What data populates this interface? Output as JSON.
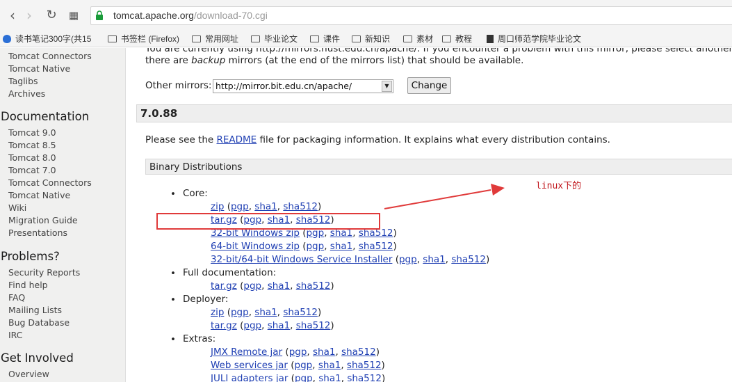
{
  "browser": {
    "url_host": "tomcat.apache.org",
    "url_path": "/download-70.cgi",
    "bookmarks": [
      {
        "label": "读书笔记300字(共15",
        "icon": "baidu-paw-icon"
      },
      {
        "label": "书签栏 (Firefox)",
        "icon": "folder-icon"
      },
      {
        "label": "常用网址",
        "icon": "folder-icon"
      },
      {
        "label": "毕业论文",
        "icon": "folder-icon"
      },
      {
        "label": "课件",
        "icon": "folder-icon"
      },
      {
        "label": "新知识",
        "icon": "folder-icon"
      },
      {
        "label": "素材",
        "icon": "folder-icon"
      },
      {
        "label": "教程",
        "icon": "folder-icon"
      },
      {
        "label": "周口师范学院毕业论文",
        "icon": "document-icon"
      }
    ]
  },
  "sidebar": {
    "top_items": [
      "Tomcat Connectors",
      "Tomcat Native",
      "Taglibs",
      "Archives"
    ],
    "documentation": {
      "heading": "Documentation",
      "items": [
        "Tomcat 9.0",
        "Tomcat 8.5",
        "Tomcat 8.0",
        "Tomcat 7.0",
        "Tomcat Connectors",
        "Tomcat Native",
        "Wiki",
        "Migration Guide",
        "Presentations"
      ]
    },
    "problems": {
      "heading": "Problems?",
      "items": [
        "Security Reports",
        "Find help",
        "FAQ",
        "Mailing Lists",
        "Bug Database",
        "IRC"
      ]
    },
    "involved": {
      "heading": "Get Involved",
      "items": [
        "Overview"
      ]
    }
  },
  "main": {
    "intro_line1": "You are currently using http://mirrors.hust.edu.cn/apache/. If you encounter a problem with this mirror, please select another m",
    "intro_line2_pre": "there are ",
    "intro_line2_em": "backup",
    "intro_line2_post": " mirrors (at the end of the mirrors list) that should be available.",
    "mirrors_label": "Other mirrors:",
    "mirror_value": "http://mirror.bit.edu.cn/apache/",
    "change_label": "Change",
    "version": "7.0.88",
    "readme_pre": "Please see the ",
    "readme_link": "README",
    "readme_post": " file for packaging information. It explains what every distribution contains.",
    "binary_heading": "Binary Distributions",
    "groups": {
      "core": "Core:",
      "fulldoc": "Full documentation:",
      "deployer": "Deployer:",
      "extras": "Extras:"
    },
    "links": {
      "zip": "zip",
      "targz": "tar.gz",
      "win32": "32-bit Windows zip",
      "win64": "64-bit Windows zip",
      "installer": "32-bit/64-bit Windows Service Installer",
      "jmx": "JMX Remote jar",
      "ws": "Web services jar",
      "juli": "JULI adapters jar",
      "pgp": "pgp",
      "sha1": "sha1",
      "sha512": "sha512"
    },
    "annotation": "linux下的"
  },
  "colors": {
    "link": "#1f3fb3",
    "annotation_red": "#c0151b",
    "highlight_box": "#e03a3a"
  }
}
